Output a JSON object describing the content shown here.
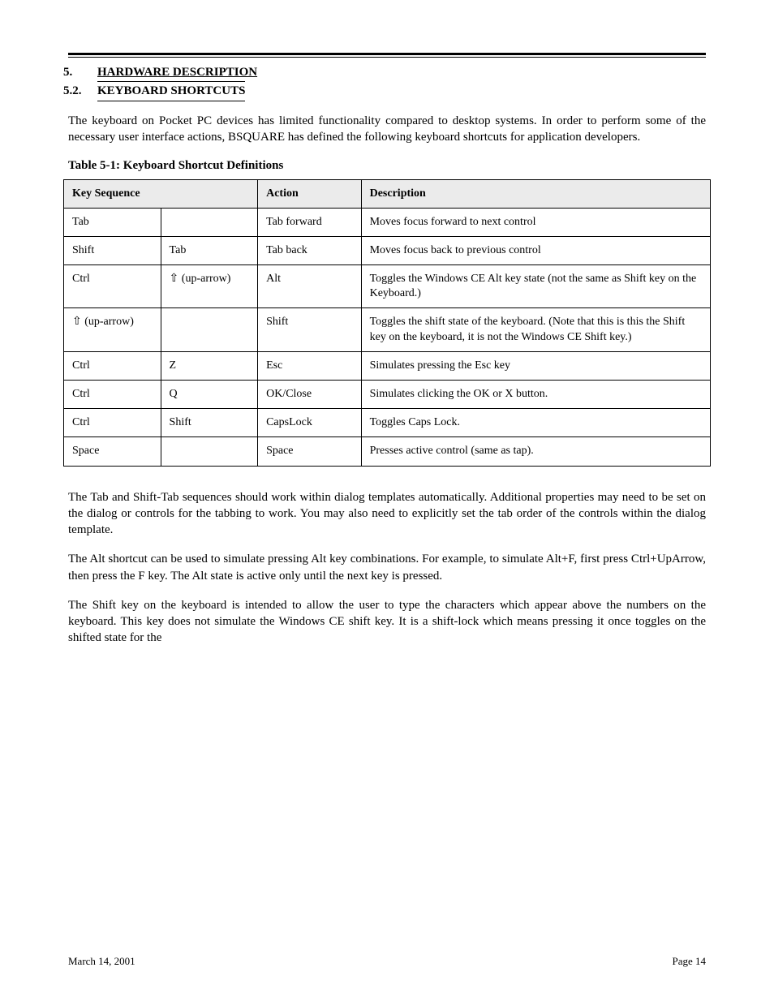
{
  "chapter": {
    "num": "5.",
    "title": "HARDWARE DESCRIPTION"
  },
  "section": {
    "num": "5.2.",
    "title": "KEYBOARD SHORTCUTS"
  },
  "intro": "The keyboard on Pocket PC devices has limited functionality compared to desktop systems. In order to perform some of the necessary user interface actions, BSQUARE has defined the following keyboard shortcuts for application developers.",
  "table_title": "Table 5-1: Keyboard Shortcut Definitions",
  "table": {
    "headers": [
      "Key Sequence",
      "Action",
      "Description"
    ],
    "rows": [
      {
        "k1": "Tab",
        "k2": "",
        "act": "Tab forward",
        "desc": "Moves focus forward to next control"
      },
      {
        "k1": "Shift",
        "k2": "Tab",
        "act": "Tab back",
        "desc": "Moves focus back to previous control"
      },
      {
        "k1": "Ctrl",
        "k2": "⇧ (up-arrow)",
        "act": "Alt",
        "desc": "Toggles the Windows CE Alt key state (not the same as Shift key on the Keyboard.)"
      },
      {
        "k1": "⇧ (up-arrow)",
        "k2": "",
        "act": "Shift",
        "desc": "Toggles the shift state of the keyboard. (Note that this is this the Shift key on the keyboard, it is not the Windows CE Shift key.)"
      },
      {
        "k1": "Ctrl",
        "k2": "Z",
        "act": "Esc",
        "desc": "Simulates pressing the Esc key"
      },
      {
        "k1": "Ctrl",
        "k2": "Q",
        "act": "OK/Close",
        "desc": "Simulates clicking the OK or X button."
      },
      {
        "k1": "Ctrl",
        "k2": "Shift",
        "act": "CapsLock",
        "desc": "Toggles Caps Lock."
      },
      {
        "k1": "Space",
        "k2": "",
        "act": "Space",
        "desc": "Presses active control (same as tap)."
      }
    ]
  },
  "notes": [
    "The Tab and Shift-Tab sequences should work within dialog templates automatically. Additional properties may need to be set on the dialog or controls for the tabbing to work. You may also need to explicitly set the tab order of the controls within the dialog template.",
    "The Alt shortcut can be used to simulate pressing Alt key combinations. For example, to simulate Alt+F, first press Ctrl+UpArrow, then press the F key. The Alt state is active only until the next key is pressed.",
    "The Shift key on the keyboard is intended to allow the user to type the characters which appear above the numbers on the keyboard. This key does not simulate the Windows CE shift key. It is a shift-lock which means pressing it once toggles on the shifted state for the"
  ],
  "footer": {
    "left": "March 14, 2001",
    "right": "Page 14"
  }
}
